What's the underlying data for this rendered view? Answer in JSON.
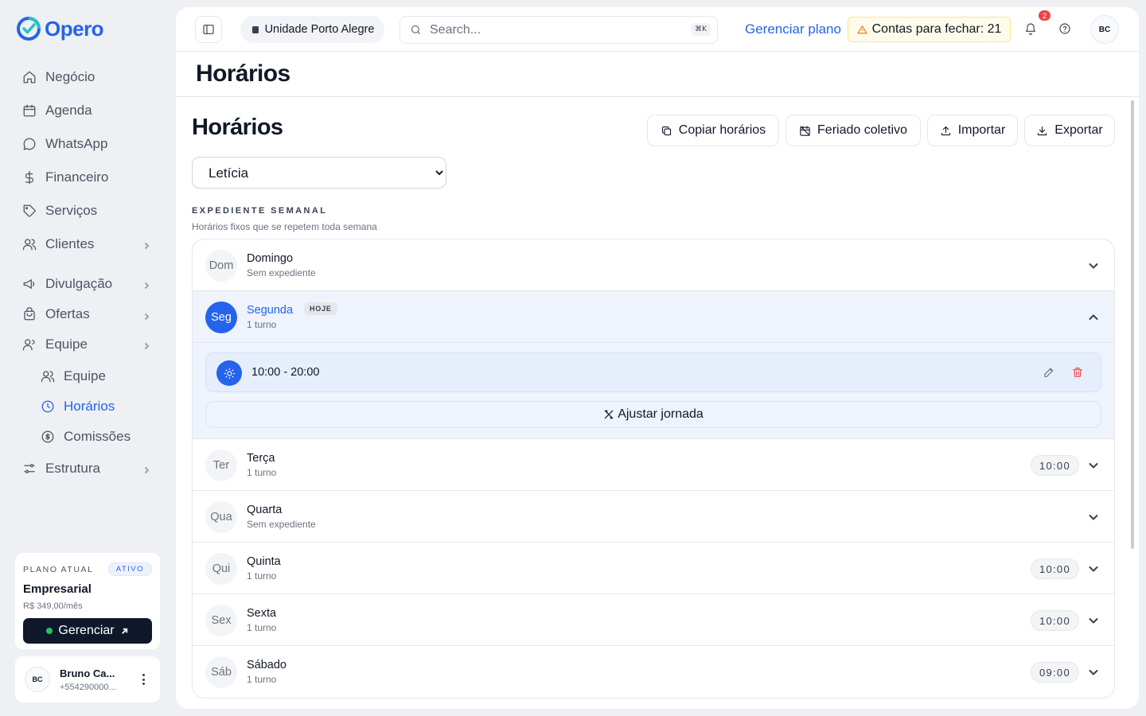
{
  "brand": {
    "name": "Opero"
  },
  "sidebar": {
    "items": [
      {
        "label": "Negócio",
        "icon": "home-icon"
      },
      {
        "label": "Agenda",
        "icon": "calendar-icon"
      },
      {
        "label": "WhatsApp",
        "icon": "chat-icon"
      },
      {
        "label": "Financeiro",
        "icon": "dollar-icon"
      },
      {
        "label": "Serviços",
        "icon": "tag-icon"
      },
      {
        "label": "Clientes",
        "icon": "users-icon"
      },
      {
        "label": "Divulgação",
        "icon": "megaphone-icon"
      },
      {
        "label": "Ofertas",
        "icon": "bag-icon"
      },
      {
        "label": "Equipe",
        "icon": "team-icon"
      },
      {
        "label": "Equipe",
        "icon": "team-icon"
      },
      {
        "label": "Horários",
        "icon": "clock-icon"
      },
      {
        "label": "Comissões",
        "icon": "coin-icon"
      },
      {
        "label": "Estrutura",
        "icon": "sliders-icon"
      }
    ]
  },
  "plan": {
    "caption": "PLANO ATUAL",
    "badge": "ATIVO",
    "name": "Empresarial",
    "price": "R$ 349,00/mês",
    "button": "Gerenciar"
  },
  "user": {
    "initials": "BC",
    "name": "Bruno Ca...",
    "phone": "+554290000..."
  },
  "topbar": {
    "unit": "Unidade Porto Alegre",
    "search_placeholder": "Search...",
    "shortcut": "⌘K",
    "manage_plan": "Gerenciar plano",
    "bills": "Contas para fechar: 21",
    "notifications": "2",
    "avatar": "BC"
  },
  "page": {
    "header_title": "Horários",
    "title": "Horários",
    "actions": {
      "copy": "Copiar horários",
      "holiday": "Feriado coletivo",
      "import": "Importar",
      "export": "Exportar"
    },
    "employee": "Letícia",
    "section_title": "EXPEDIENTE SEMANAL",
    "section_subtitle": "Horários fixos que se repetem toda semana"
  },
  "days": [
    {
      "short": "Dom",
      "name": "Domingo",
      "info": "Sem expediente",
      "time": ""
    },
    {
      "short": "Seg",
      "name": "Segunda",
      "info": "1 turno",
      "time": "",
      "badge": "HOJE"
    },
    {
      "short": "Ter",
      "name": "Terça",
      "info": "1 turno",
      "time": "10:00"
    },
    {
      "short": "Qua",
      "name": "Quarta",
      "info": "Sem expediente",
      "time": ""
    },
    {
      "short": "Qui",
      "name": "Quinta",
      "info": "1 turno",
      "time": "10:00"
    },
    {
      "short": "Sex",
      "name": "Sexta",
      "info": "1 turno",
      "time": "10:00"
    },
    {
      "short": "Sáb",
      "name": "Sábado",
      "info": "1 turno",
      "time": "09:00"
    }
  ],
  "expanded": {
    "shift": "10:00 - 20:00",
    "adjust": "Ajustar jornada"
  },
  "colors": {
    "accent": "#2563eb",
    "danger": "#ef4444",
    "warning_bg": "#fffbeb"
  }
}
